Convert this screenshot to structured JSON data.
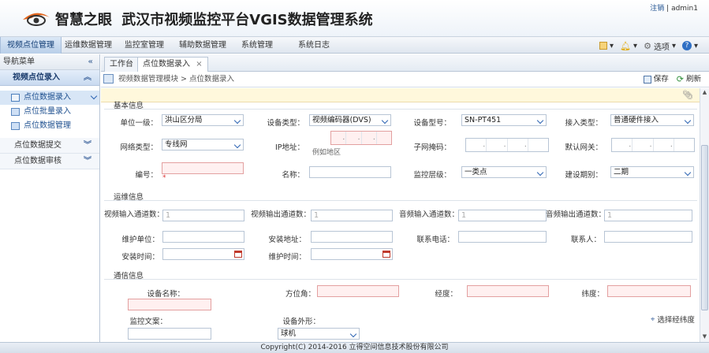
{
  "header": {
    "logo_text": "智慧之眼",
    "title": "武汉市视频监控平台VGIS数据管理系统",
    "user": {
      "logout": "注销",
      "separator": "|",
      "username": "admin1"
    }
  },
  "menu": {
    "items": [
      "视频点位管理",
      "运维数据管理",
      "监控室管理",
      "辅助数据管理",
      "系统管理",
      "系统日志"
    ],
    "active_index": 0,
    "tools": {
      "options_label": "选项"
    }
  },
  "sidebar": {
    "title": "导航菜单",
    "groups": [
      {
        "label": "视频点位录入",
        "expanded": true,
        "items": [
          "点位数据录入",
          "点位批量录入",
          "点位数据管理"
        ]
      },
      {
        "label": "点位数据提交",
        "expanded": false
      },
      {
        "label": "点位数据审核",
        "expanded": false
      }
    ]
  },
  "tabs": [
    {
      "label": "工作台"
    },
    {
      "label": "点位数据录入",
      "closable": true,
      "close": "×"
    }
  ],
  "breadcrumb": {
    "text": "视频数据管理模块  >  点位数据录入"
  },
  "actions": {
    "save": "保存",
    "refresh": "刷新"
  },
  "form": {
    "sections": {
      "basic": "基本信息",
      "ops": "运维信息",
      "comm": "通信信息"
    },
    "basic": {
      "unit_label": "单位一级：",
      "unit_value": "洪山区分局",
      "device_type_label": "设备类型：",
      "device_type_value": "视频编码器(DVS)",
      "device_model_label": "设备型号：",
      "device_model_value": "SN-PT451",
      "access_label": "接入类型：",
      "access_value": "普通硬件接入",
      "network_label": "网络类型：",
      "network_value": "专线网",
      "ip_label": "IP地址：",
      "ip_hint": "例如地区",
      "mask_label": "子网掩码：",
      "gateway_label": "默认网关：",
      "id_label": "编号：",
      "id_required_mark": "*",
      "name_label": "名称：",
      "level_label": "监控层级：",
      "level_value": "一类点",
      "phase_label": "建设期别：",
      "phase_value": "二期"
    },
    "ops": {
      "video_in_label": "视频输入通道数：",
      "video_in_value": "1",
      "video_out_label": "视频输出通道数：",
      "video_out_value": "1",
      "audio_in_label": "音频输入通道数：",
      "audio_in_value": "1",
      "audio_out_label": "音频输出通道数：",
      "audio_out_value": "1",
      "maint_unit_label": "维护单位：",
      "install_addr_label": "安装地址：",
      "phone_label": "联系电话：",
      "contact_label": "联系人：",
      "install_time_label": "安装时间：",
      "maint_time_label": "维护时间："
    },
    "comm": {
      "place_label": "设备名称：",
      "direction_label": "方位角：",
      "lon_label": "经度：",
      "lat_label": "纬度：",
      "camera_doc_label": "监控文案：",
      "device_shape_label": "设备外形：",
      "device_shape_value": "球机",
      "add_button": "选择经纬度"
    }
  },
  "footer": {
    "copyright": "Copyright(C) 2014-2016 立得空间信息技术股份有限公司"
  }
}
